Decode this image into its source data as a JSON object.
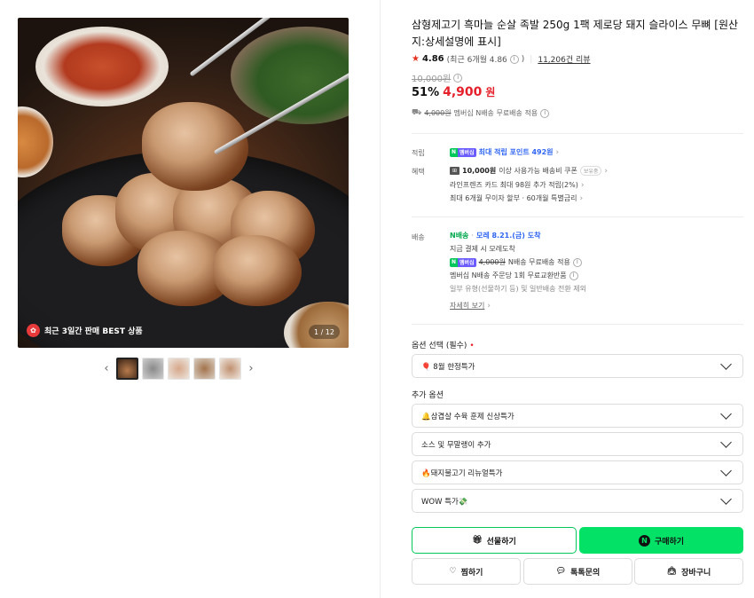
{
  "gallery": {
    "badge_icon": "gift-icon",
    "badge_text": "최근 3일간 판매 BEST 상품",
    "counter": "1 / 12",
    "prev_icon": "chevron-left-icon",
    "next_icon": "chevron-right-icon",
    "thumbnail_count": 5
  },
  "product": {
    "title": "삼형제고기 흑마늘 순살 족발 250g 1팩 제로당 돼지 슬라이스 무뼈 [원산지:상세설명에 표시]",
    "rating_score": "4.86",
    "rating_recent": "(최근 6개월 4.86",
    "review_count": "11,206건 리뷰",
    "original_price": "10,000원",
    "discount": "51%",
    "sale_price": "4,900",
    "won": "원",
    "shipping_original": "4,000원",
    "shipping_text": "멤버십 N배송 무료배송 적용"
  },
  "benefits": {
    "points_label": "적립",
    "points_badge_n": "N",
    "points_badge_m": "멤버십",
    "points_text": "최대 적립 포인트 492원",
    "benefit_label": "혜택",
    "coupon_icon": "coupon-icon",
    "coupon_amount": "10,000원",
    "coupon_text": "이상 사용가능 배송비 쿠폰",
    "coupon_tag": "보유중",
    "card_text": "라인프렌즈 카드 최대 98원 추가 적립(2%)",
    "installment_text": "최대 6개월 무이자 할부 · 60개월 특별금리"
  },
  "delivery": {
    "label": "배송",
    "n_delivery": "N배송",
    "arrival": "모레 8.21.(금) 도착",
    "order_note": "지금 결제 시 모레도착",
    "shipping_original": "4,000원",
    "shipping_text": "N배송 무료배송 적용",
    "exchange_text": "멤버십 N배송 주문당 1회 무료교환반품",
    "exclusion_text": "일부 유형(선물하기 등) 및 일반배송 전환 제외",
    "detail_link": "자세히 보기"
  },
  "options": {
    "required_label": "옵션 선택 (필수)",
    "required_mark": "•",
    "required_value": "🎈 8월 한정특가",
    "additional_label": "추가 옵션",
    "additional": [
      "🔔삼겹살 수육 훈제 신상특가",
      "소스 및 무말랭이 추가",
      "🔥돼지불고기 리뉴얼특가",
      "WOW 특가💸"
    ]
  },
  "actions": {
    "gift": "선물하기",
    "buy": "구매하기",
    "wish": "찜하기",
    "talk": "톡톡문의",
    "cart": "장바구니"
  },
  "colors": {
    "accent_green": "#03e266",
    "sale_red": "#e5202a",
    "link_blue": "#2f66f3"
  }
}
